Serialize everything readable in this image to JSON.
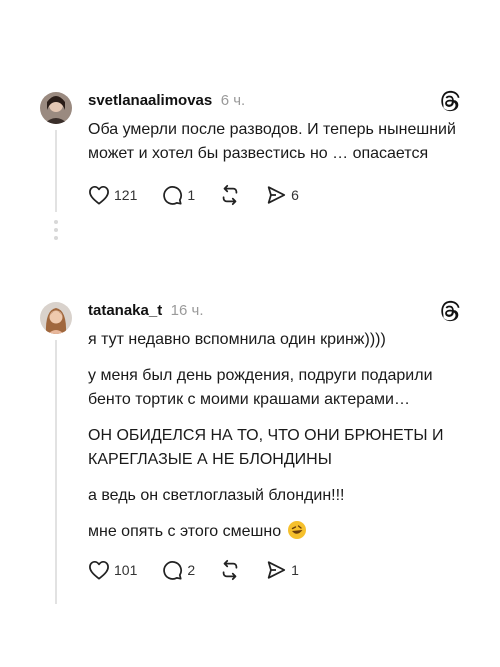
{
  "posts": [
    {
      "username": "svetlanaalimovas",
      "time": "6 ч.",
      "paragraphs": [
        "Оба умерли после разводов. И теперь нынешний может и хотел бы развестись но … опасается"
      ],
      "likes": "121",
      "replies": "1",
      "reposts": "",
      "shares": "6"
    },
    {
      "username": "tatanaka_t",
      "time": "16 ч.",
      "paragraphs": [
        "я тут недавно вспомнила один кринж))))",
        "у меня был день рождения, подруги подарили бенто тортик с моими крашами актерами…",
        "ОН ОБИДЕЛСЯ НА ТО, ЧТО ОНИ БРЮНЕТЫ И КАРЕГЛАЗЫЕ А НЕ БЛОНДИНЫ",
        "а ведь он светлоглазый блондин!!!",
        "мне опять с этого смешно"
      ],
      "emoji": "🤣",
      "likes": "101",
      "replies": "2",
      "reposts": "",
      "shares": "1"
    }
  ],
  "icons": {
    "like": "heart-icon",
    "reply": "comment-icon",
    "repost": "repost-icon",
    "share": "share-icon",
    "brand": "threads-logo-icon"
  },
  "colors": {
    "text": "#141414",
    "muted": "#9a9a9a",
    "thread_line": "#e2e2e2"
  }
}
